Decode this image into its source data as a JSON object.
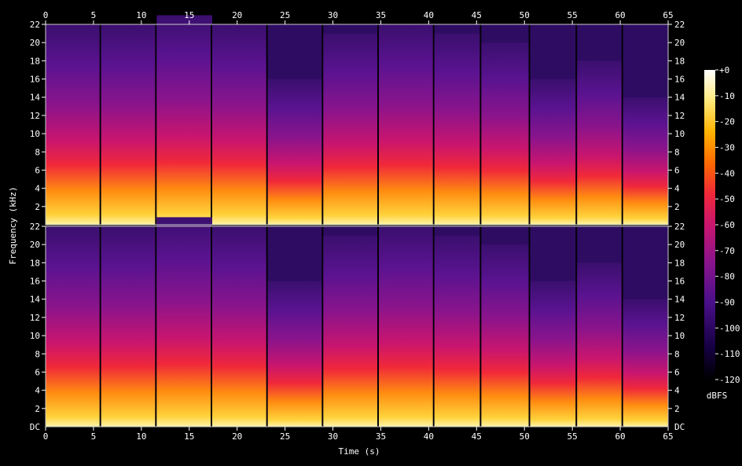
{
  "chart_data": {
    "type": "heatmap",
    "title": "",
    "xlabel": "Time (s)",
    "ylabel": "Frequency (kHz)",
    "xlim": [
      0,
      65
    ],
    "ylim": [
      0,
      22
    ],
    "x_ticks": [
      0,
      5,
      10,
      15,
      20,
      25,
      30,
      35,
      40,
      45,
      50,
      55,
      60,
      65
    ],
    "y_ticks": [
      2,
      4,
      6,
      8,
      10,
      12,
      14,
      16,
      18,
      20,
      22
    ],
    "y_zero_label": "DC",
    "channels": 2,
    "segment_boundaries_s": [
      5.8,
      11.6,
      17.4,
      23.2,
      29.0,
      34.8,
      40.6,
      45.5,
      50.6,
      55.5,
      60.3
    ],
    "segment_rolloff_khz": [
      16,
      16,
      17,
      16,
      10,
      15,
      16,
      15,
      14,
      10,
      12,
      8
    ],
    "colorbar": {
      "label": "dBFS",
      "ticks": [
        "+0",
        "-10",
        "-20",
        "-30",
        "-40",
        "-50",
        "-60",
        "-70",
        "-80",
        "-90",
        "-100",
        "-110",
        "-120"
      ],
      "range": [
        -120,
        0
      ],
      "colors": [
        "#000000",
        "#140040",
        "#4a0f8a",
        "#8a148c",
        "#c9156e",
        "#f0283a",
        "#ff6a00",
        "#ffb300",
        "#ffe97a",
        "#ffffff"
      ]
    }
  }
}
